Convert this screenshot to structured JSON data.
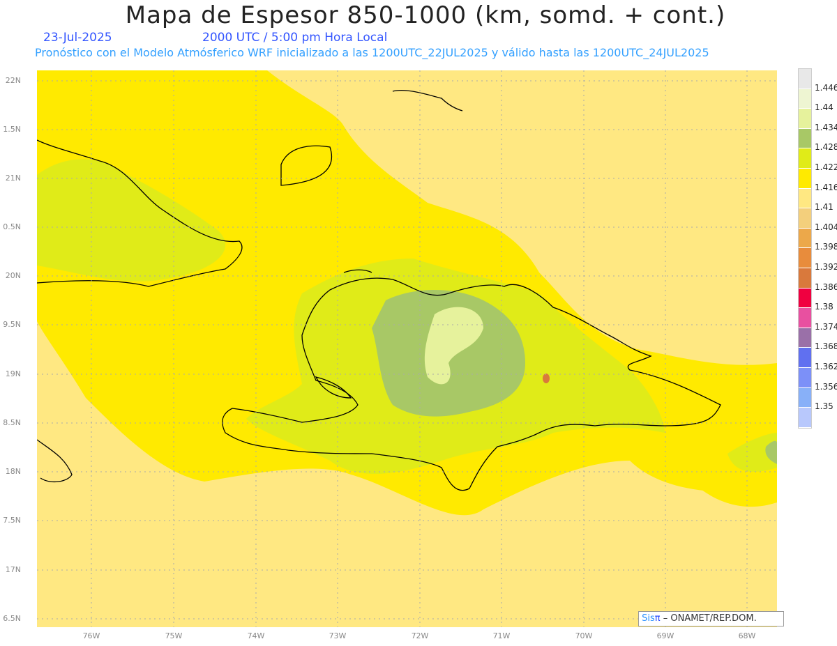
{
  "header": {
    "title": "Mapa de Espesor 850-1000 (km, somd. + cont.)",
    "date": "23-Jul-2025",
    "valid_time": "2000 UTC / 5:00 pm Hora Local",
    "subtitle": "Pronóstico con el Modelo Atmósferico WRF inicializado a las 1200UTC_22JUL2025 y válido hasta las  1200UTC_24JUL2025"
  },
  "axes": {
    "lat_labels": [
      "22N",
      "1.5N",
      "21N",
      "0.5N",
      "20N",
      "9.5N",
      "19N",
      "8.5N",
      "18N",
      "7.5N",
      "17N",
      "6.5N"
    ],
    "lon_labels": [
      "76W",
      "75W",
      "74W",
      "73W",
      "72W",
      "71W",
      "70W",
      "69W",
      "68W"
    ]
  },
  "colorbar": {
    "labels": [
      "1.446",
      "1.44",
      "1.434",
      "1.428",
      "1.422",
      "1.416",
      "1.41",
      "1.404",
      "1.398",
      "1.392",
      "1.386",
      "1.38",
      "1.374",
      "1.368",
      "1.362",
      "1.356",
      "1.35"
    ],
    "colors": [
      "#e8e8e8",
      "#eef5d2",
      "#e6f29c",
      "#a8c866",
      "#e0eb18",
      "#ffea00",
      "#ffe882",
      "#f3cf7c",
      "#eca84a",
      "#e88c3c",
      "#d9793c",
      "#f00040",
      "#e850a0",
      "#9a70a8",
      "#6070f0",
      "#7c90f8",
      "#88b0f8",
      "#b8c8fc"
    ]
  },
  "credit": {
    "brand": "Sis",
    "pi": "π",
    "text": " – ONAMET/REP.DOM."
  }
}
